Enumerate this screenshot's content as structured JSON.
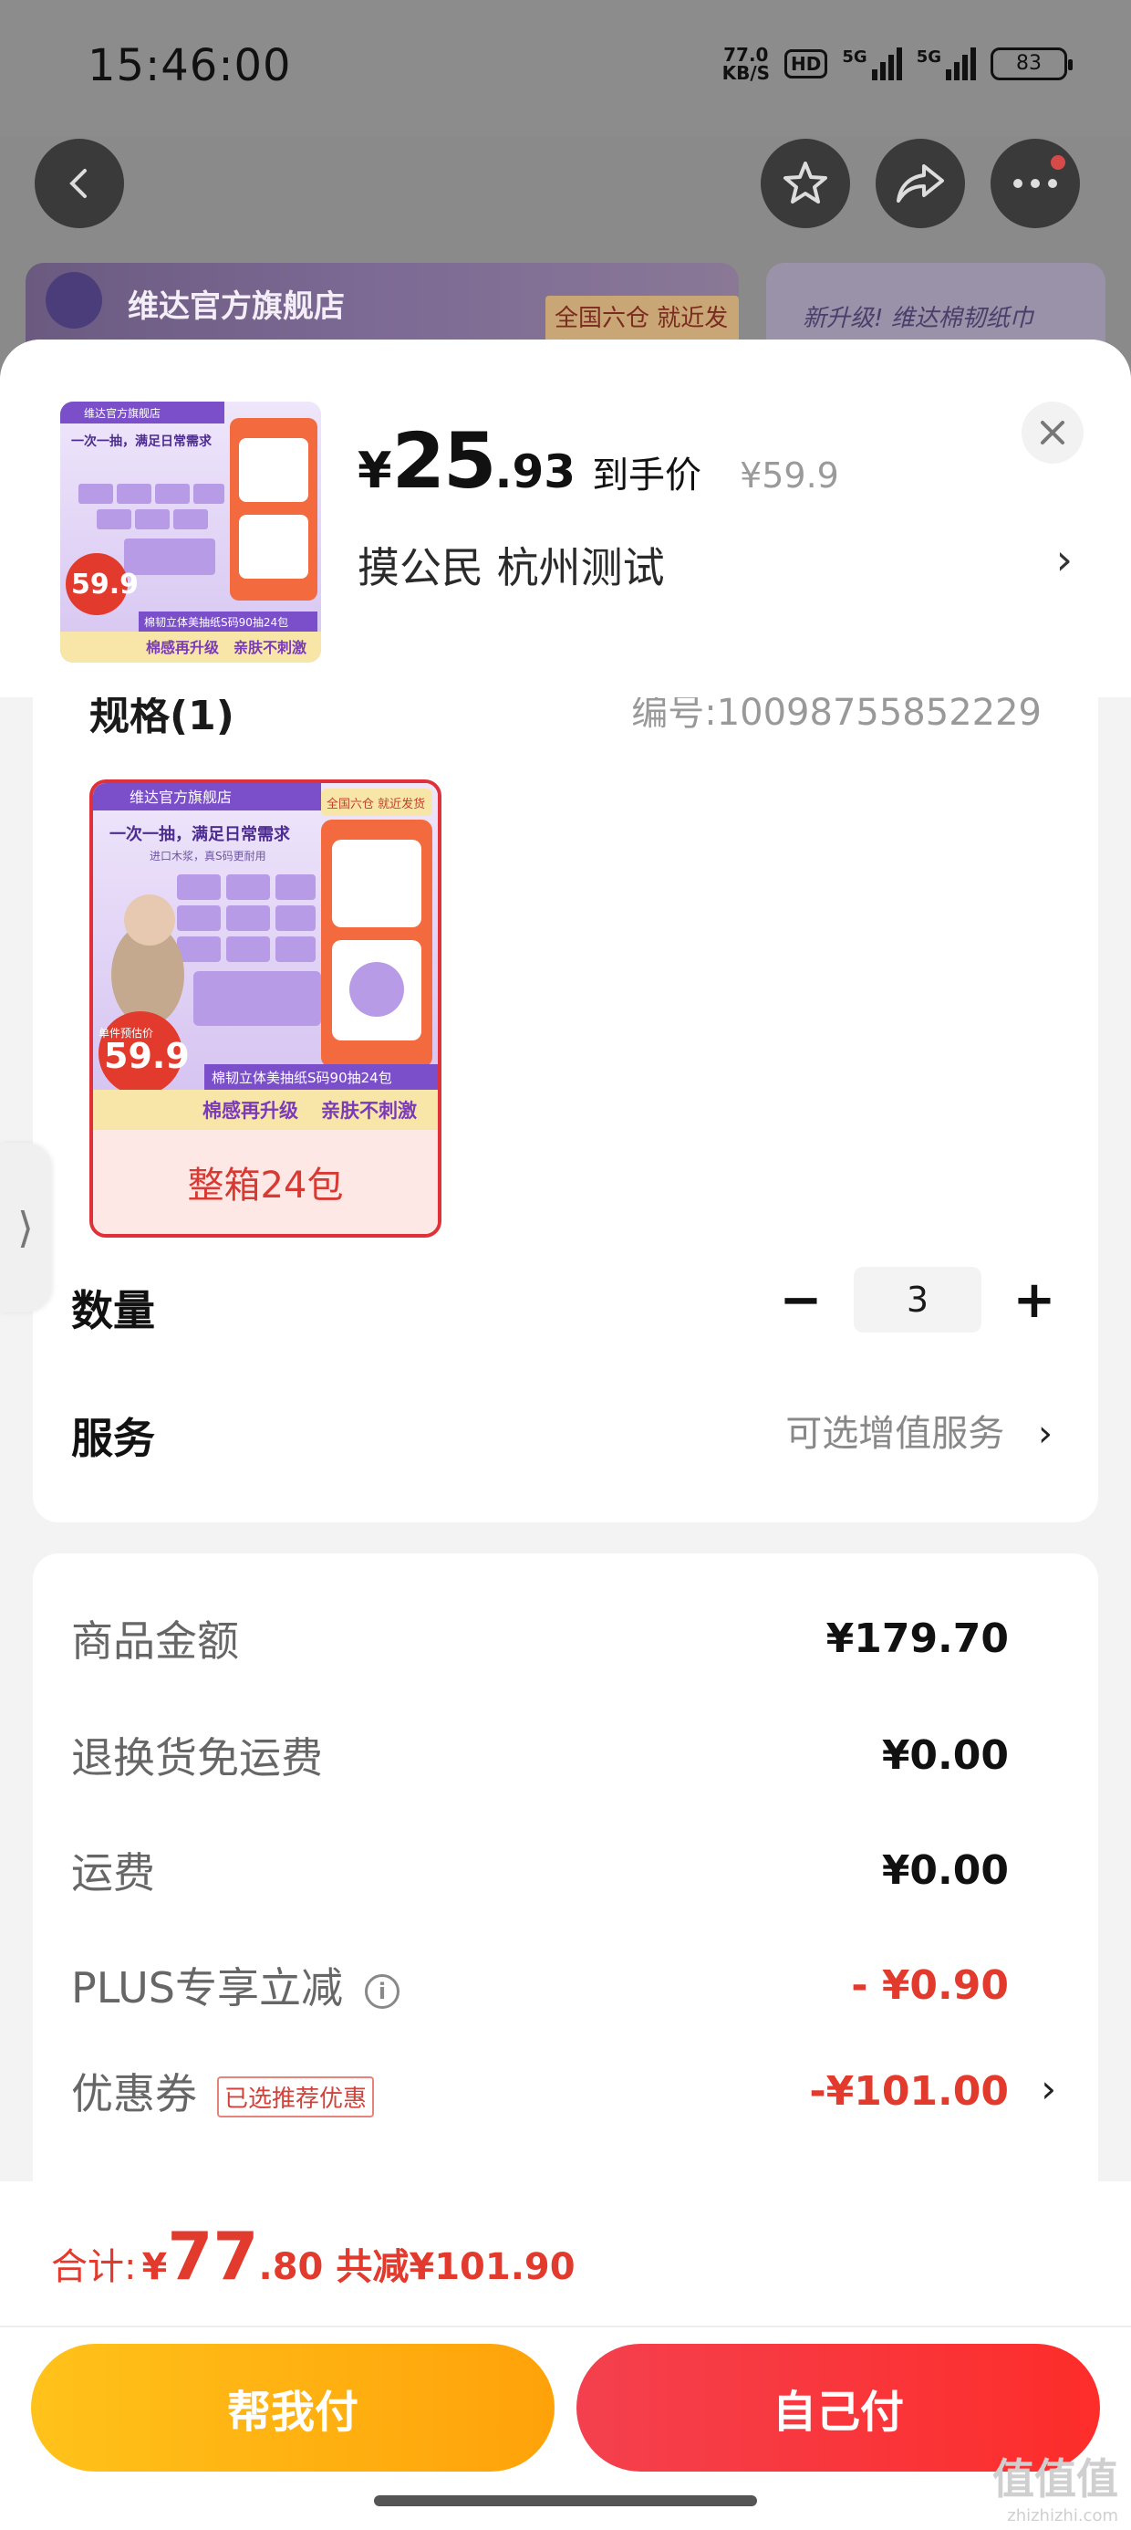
{
  "status": {
    "time": "15:46:00",
    "net_speed_value": "77.0",
    "net_speed_unit": "KB/S",
    "hd_label": "HD",
    "signal1_label": "5G",
    "signal2_label": "5G",
    "battery": "83"
  },
  "background": {
    "store_banner": "维达官方旗舰店",
    "store_tag": "全国六仓 就近发货",
    "second_banner": "新升级! 维达棉韧纸巾"
  },
  "product": {
    "currency": "¥",
    "price_int": "25",
    "price_dec": ".93",
    "price_tag": "到手价",
    "original_price": "¥59.9",
    "address": "摸公民  杭州测试"
  },
  "thumbnail": {
    "store": "维达官方旗舰店",
    "slogan": "一次一抽，满足日常需求",
    "sub": "进口木浆，真S码更耐用",
    "est_price_label": "单件预估价",
    "est_price": "59.9",
    "product_line": "棉韧立体美抽纸S码90抽24包",
    "tagline_left": "棉感再升级",
    "tagline_right": "亲肤不刺激",
    "top_tag": "全国六仓 就近发货"
  },
  "spec": {
    "title": "规格(1)",
    "number": "编号:10098755852229",
    "option_label": "整箱24包"
  },
  "quantity": {
    "label": "数量",
    "minus": "−",
    "value": "3",
    "plus": "+"
  },
  "service": {
    "label": "服务",
    "value": "可选增值服务"
  },
  "fees": {
    "goods_label": "商品金额",
    "goods_value": "¥179.70",
    "return_label": "退换货免运费",
    "return_value": "¥0.00",
    "shipping_label": "运费",
    "shipping_value": "¥0.00",
    "plus_label": "PLUS专享立减",
    "plus_value": "- ¥0.90",
    "coupon_label": "优惠券",
    "coupon_badge": "已选推荐优惠",
    "coupon_value": "-¥101.00"
  },
  "total": {
    "label": "合计:",
    "currency": "¥",
    "int": "77",
    "dec": ".80",
    "saved": "共减¥101.90"
  },
  "actions": {
    "help_pay": "帮我付",
    "self_pay": "自己付"
  },
  "watermark": {
    "mark": "值值值",
    "site": "zhizhizhi.com"
  },
  "colors": {
    "accent_red": "#e23a2d",
    "help_pay_yellow": "#ffb312",
    "self_pay_red": "#f5333f"
  }
}
